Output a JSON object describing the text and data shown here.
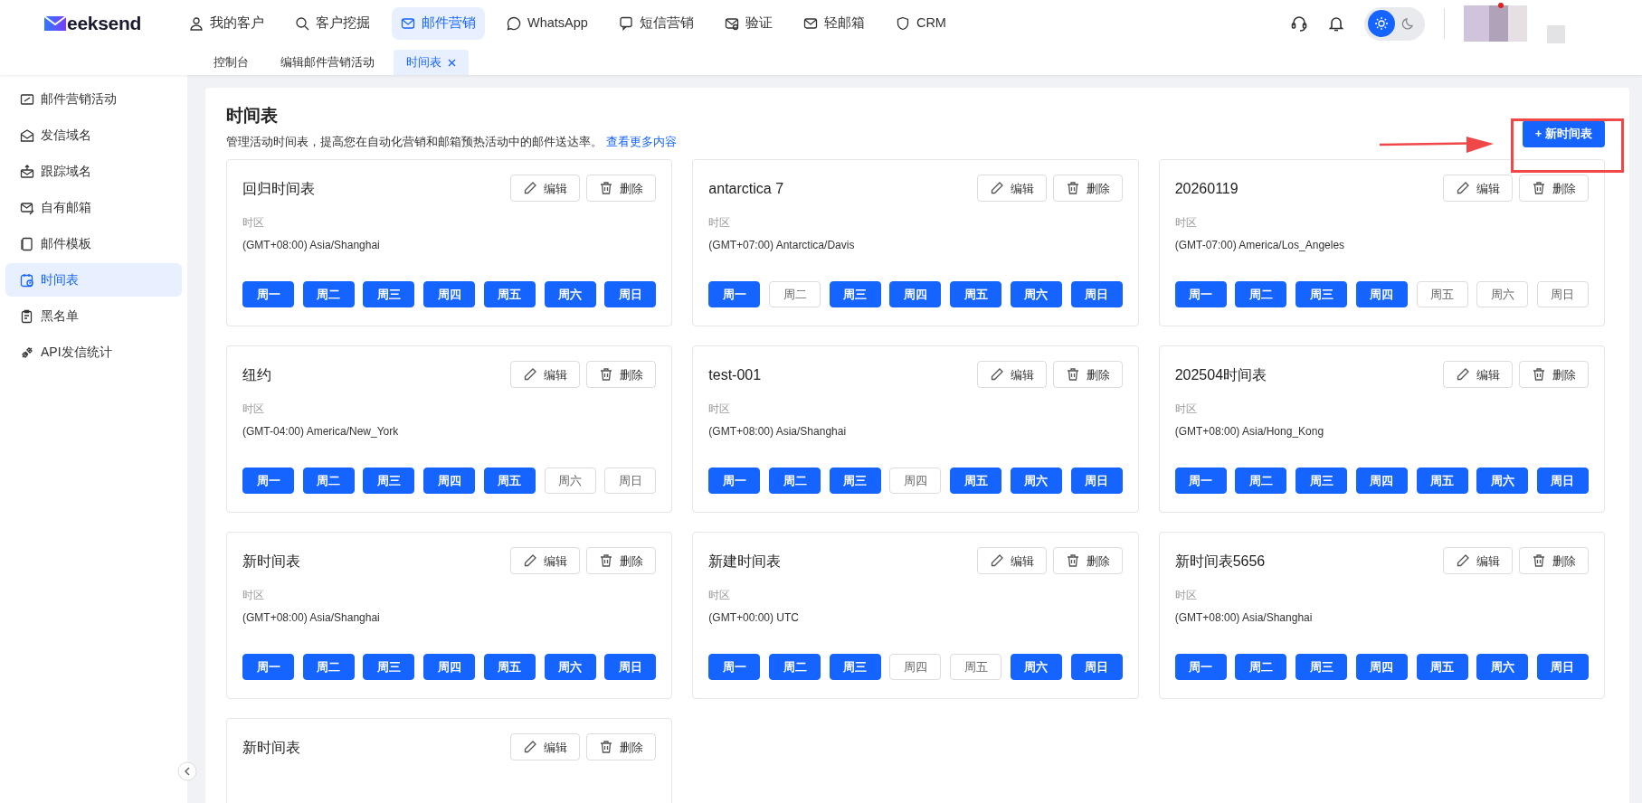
{
  "brand": {
    "name": "eeksend"
  },
  "nav": [
    {
      "label": "我的客户",
      "selected": false
    },
    {
      "label": "客户挖掘",
      "selected": false
    },
    {
      "label": "邮件营销",
      "selected": true
    },
    {
      "label": "WhatsApp",
      "selected": false
    },
    {
      "label": "短信营销",
      "selected": false
    },
    {
      "label": "验证",
      "selected": false
    },
    {
      "label": "轻邮箱",
      "selected": false
    },
    {
      "label": "CRM",
      "selected": false
    }
  ],
  "theme_toggle": [
    {
      "kind": "sun",
      "selected": true
    },
    {
      "kind": "moon",
      "selected": false
    }
  ],
  "tabs": [
    {
      "label": "控制台",
      "selected": false,
      "closable": false
    },
    {
      "label": "编辑邮件营销活动",
      "selected": false,
      "closable": false
    },
    {
      "label": "时间表",
      "selected": true,
      "closable": true
    }
  ],
  "sidebar": {
    "items": [
      {
        "label": "邮件营销活动",
        "selected": false
      },
      {
        "label": "发信域名",
        "selected": false
      },
      {
        "label": "跟踪域名",
        "selected": false
      },
      {
        "label": "自有邮箱",
        "selected": false
      },
      {
        "label": "邮件模板",
        "selected": false
      },
      {
        "label": "时间表",
        "selected": true
      },
      {
        "label": "黑名单",
        "selected": false
      },
      {
        "label": "API发信统计",
        "selected": false
      }
    ]
  },
  "page": {
    "title": "时间表",
    "description": "管理活动时间表，提高您在自动化营销和邮箱预热活动中的邮件送达率。",
    "link": "查看更多内容",
    "new_button": "+ 新时间表"
  },
  "schedules": [
    {
      "name": "回归时间表",
      "edit": "编辑",
      "delete": "删除",
      "timezone_label": "时区",
      "timezone": "(GMT+08:00) Asia/Shanghai",
      "days": [
        {
          "label": "周一",
          "selected": true
        },
        {
          "label": "周二",
          "selected": true
        },
        {
          "label": "周三",
          "selected": true
        },
        {
          "label": "周四",
          "selected": true
        },
        {
          "label": "周五",
          "selected": true
        },
        {
          "label": "周六",
          "selected": true
        },
        {
          "label": "周日",
          "selected": true
        }
      ]
    },
    {
      "name": "antarctica 7",
      "edit": "编辑",
      "delete": "删除",
      "timezone_label": "时区",
      "timezone": "(GMT+07:00) Antarctica/Davis",
      "days": [
        {
          "label": "周一",
          "selected": true
        },
        {
          "label": "周二",
          "selected": false
        },
        {
          "label": "周三",
          "selected": true
        },
        {
          "label": "周四",
          "selected": true
        },
        {
          "label": "周五",
          "selected": true
        },
        {
          "label": "周六",
          "selected": true
        },
        {
          "label": "周日",
          "selected": true
        }
      ]
    },
    {
      "name": "20260119",
      "edit": "编辑",
      "delete": "删除",
      "timezone_label": "时区",
      "timezone": "(GMT-07:00) America/Los_Angeles",
      "days": [
        {
          "label": "周一",
          "selected": true
        },
        {
          "label": "周二",
          "selected": true
        },
        {
          "label": "周三",
          "selected": true
        },
        {
          "label": "周四",
          "selected": true
        },
        {
          "label": "周五",
          "selected": false
        },
        {
          "label": "周六",
          "selected": false
        },
        {
          "label": "周日",
          "selected": false
        }
      ]
    },
    {
      "name": "纽约",
      "edit": "编辑",
      "delete": "删除",
      "timezone_label": "时区",
      "timezone": "(GMT-04:00) America/New_York",
      "days": [
        {
          "label": "周一",
          "selected": true
        },
        {
          "label": "周二",
          "selected": true
        },
        {
          "label": "周三",
          "selected": true
        },
        {
          "label": "周四",
          "selected": true
        },
        {
          "label": "周五",
          "selected": true
        },
        {
          "label": "周六",
          "selected": false
        },
        {
          "label": "周日",
          "selected": false
        }
      ]
    },
    {
      "name": "test-001",
      "edit": "编辑",
      "delete": "删除",
      "timezone_label": "时区",
      "timezone": "(GMT+08:00) Asia/Shanghai",
      "days": [
        {
          "label": "周一",
          "selected": true
        },
        {
          "label": "周二",
          "selected": true
        },
        {
          "label": "周三",
          "selected": true
        },
        {
          "label": "周四",
          "selected": false
        },
        {
          "label": "周五",
          "selected": true
        },
        {
          "label": "周六",
          "selected": true
        },
        {
          "label": "周日",
          "selected": true
        }
      ]
    },
    {
      "name": "202504时间表",
      "edit": "编辑",
      "delete": "删除",
      "timezone_label": "时区",
      "timezone": "(GMT+08:00) Asia/Hong_Kong",
      "days": [
        {
          "label": "周一",
          "selected": true
        },
        {
          "label": "周二",
          "selected": true
        },
        {
          "label": "周三",
          "selected": true
        },
        {
          "label": "周四",
          "selected": true
        },
        {
          "label": "周五",
          "selected": true
        },
        {
          "label": "周六",
          "selected": true
        },
        {
          "label": "周日",
          "selected": true
        }
      ]
    },
    {
      "name": "新时间表",
      "edit": "编辑",
      "delete": "删除",
      "timezone_label": "时区",
      "timezone": "(GMT+08:00) Asia/Shanghai",
      "days": [
        {
          "label": "周一",
          "selected": true
        },
        {
          "label": "周二",
          "selected": true
        },
        {
          "label": "周三",
          "selected": true
        },
        {
          "label": "周四",
          "selected": true
        },
        {
          "label": "周五",
          "selected": true
        },
        {
          "label": "周六",
          "selected": true
        },
        {
          "label": "周日",
          "selected": true
        }
      ]
    },
    {
      "name": "新建时间表",
      "edit": "编辑",
      "delete": "删除",
      "timezone_label": "时区",
      "timezone": "(GMT+00:00) UTC",
      "days": [
        {
          "label": "周一",
          "selected": true
        },
        {
          "label": "周二",
          "selected": true
        },
        {
          "label": "周三",
          "selected": true
        },
        {
          "label": "周四",
          "selected": false
        },
        {
          "label": "周五",
          "selected": false
        },
        {
          "label": "周六",
          "selected": true
        },
        {
          "label": "周日",
          "selected": true
        }
      ]
    },
    {
      "name": "新时间表5656",
      "edit": "编辑",
      "delete": "删除",
      "timezone_label": "时区",
      "timezone": "(GMT+08:00) Asia/Shanghai",
      "days": [
        {
          "label": "周一",
          "selected": true
        },
        {
          "label": "周二",
          "selected": true
        },
        {
          "label": "周三",
          "selected": true
        },
        {
          "label": "周四",
          "selected": true
        },
        {
          "label": "周五",
          "selected": true
        },
        {
          "label": "周六",
          "selected": true
        },
        {
          "label": "周日",
          "selected": true
        }
      ]
    },
    {
      "name": "新时间表",
      "edit": "编辑",
      "delete": "删除"
    }
  ]
}
